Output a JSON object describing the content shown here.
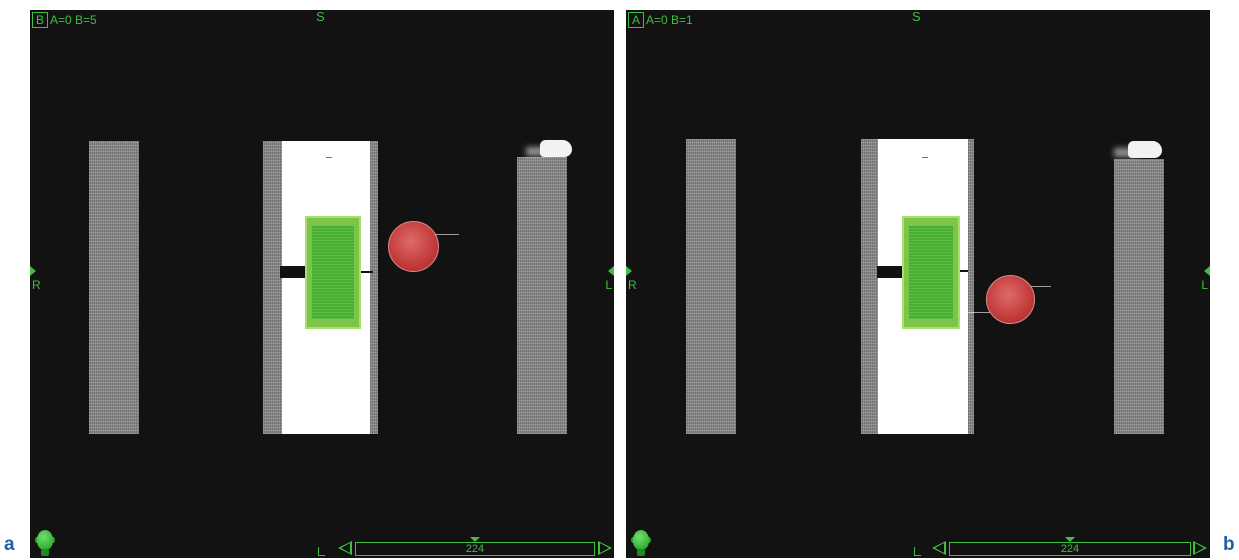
{
  "figure": {
    "label_a": "a",
    "label_b": "b"
  },
  "panels": [
    {
      "view_label": "B",
      "counts_text": "A=0 B=5",
      "orientation": {
        "superior": "S",
        "right": "R",
        "left": "L"
      },
      "slice_number": "224"
    },
    {
      "view_label": "A",
      "counts_text": "A=0 B=1",
      "orientation": {
        "superior": "S",
        "right": "R",
        "left": "L"
      },
      "slice_number": "224"
    }
  ],
  "colors": {
    "overlay_green": "#3fbf3f",
    "label_blue": "#1f5fa8",
    "target_green": "#4fb936",
    "marker_red": "#c23a3a"
  },
  "icons": [
    "head-orientation-icon",
    "slider-left-arrow-icon",
    "slider-right-arrow-icon"
  ]
}
